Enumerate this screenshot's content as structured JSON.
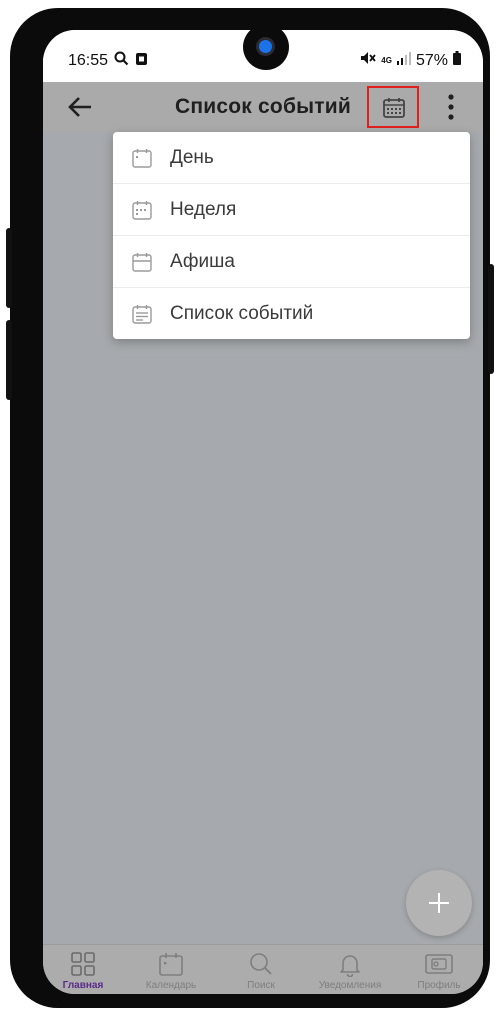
{
  "status_bar": {
    "time": "16:55",
    "network": "4G",
    "battery": "57%"
  },
  "app_bar": {
    "title": "Список событий"
  },
  "view_menu": {
    "items": [
      {
        "label": "День",
        "icon": "calendar-day-icon"
      },
      {
        "label": "Неделя",
        "icon": "calendar-week-icon"
      },
      {
        "label": "Афиша",
        "icon": "calendar-poster-icon"
      },
      {
        "label": "Список событий",
        "icon": "calendar-list-icon"
      }
    ]
  },
  "bottom_nav": {
    "items": [
      {
        "label": "Главная",
        "icon": "grid-icon",
        "active": true
      },
      {
        "label": "Календарь",
        "icon": "calendar-icon",
        "active": false
      },
      {
        "label": "Поиск",
        "icon": "search-icon",
        "active": false
      },
      {
        "label": "Уведомления",
        "icon": "bell-icon",
        "active": false
      },
      {
        "label": "Профиль",
        "icon": "profile-card-icon",
        "active": false
      }
    ]
  },
  "colors": {
    "highlight": "#e0201e",
    "active_nav": "#5a2a8a",
    "overlay": "#a6a9ad"
  }
}
